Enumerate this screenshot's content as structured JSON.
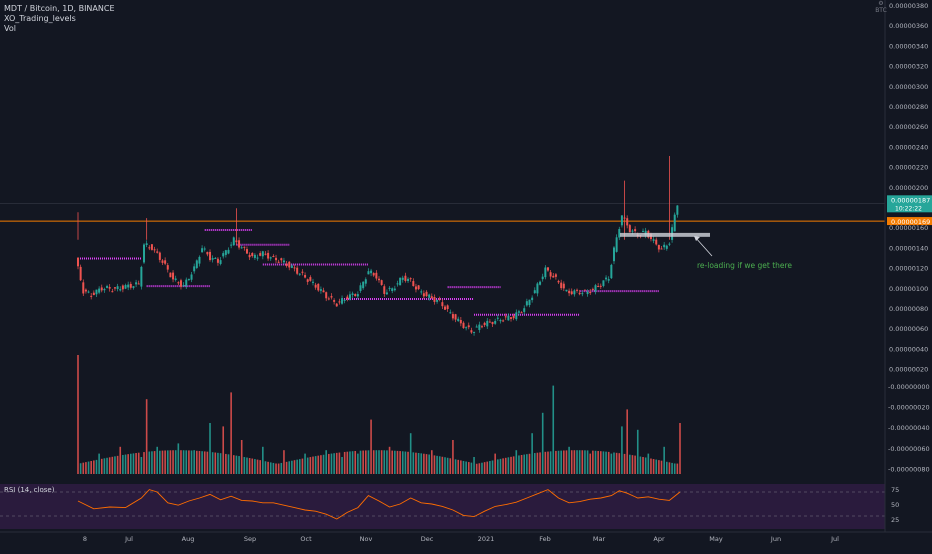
{
  "legend": {
    "symbol": "MDT / Bitcoin, 1D, BINANCE",
    "indicator": "XO_Trading_levels",
    "volume": "Vol"
  },
  "rsi": {
    "label": "RSI (14, close)"
  },
  "corner": {
    "icon": "settings-icon",
    "label": "BTC"
  },
  "annotation": {
    "text": "re-loading if we get there"
  },
  "colors": {
    "background": "#131722",
    "up": "#26a69a",
    "down": "#ef5350",
    "resistance": "#f57c00",
    "levels": "#e040fb",
    "levels_green": "#4caf50",
    "rsi_line": "#ff6d00",
    "rsi_band": "#2a1b3d",
    "text": "#b2b5be",
    "current_price_bg": "#26a69a",
    "resistance_bg": "#f57c00"
  },
  "chart_data": {
    "type": "candlestick",
    "price_axis": {
      "ticks": [
        "0.00000380",
        "0.00000360",
        "0.00000340",
        "0.00000320",
        "0.00000300",
        "0.00000280",
        "0.00000260",
        "0.00000240",
        "0.00000220",
        "0.00000200",
        "0.00000180",
        "0.00000160",
        "0.00000140",
        "0.00000120",
        "0.00000100",
        "0.00000080",
        "0.00000060",
        "0.00000040",
        "0.00000020"
      ],
      "ylim": [
        2e-07,
        3.8e-06
      ]
    },
    "volume_axis": {
      "ticks": [
        "-0.00000000",
        "-0.00000020",
        "-0.00000040",
        "-0.00000060",
        "-0.00000080"
      ]
    },
    "rsi_axis": {
      "ticks": [
        "75",
        "50",
        "25"
      ],
      "ylim": [
        0,
        100
      ],
      "overbought": 70,
      "oversold": 30
    },
    "time_axis": [
      "8",
      "Jul",
      "Aug",
      "Sep",
      "Oct",
      "Nov",
      "Dec",
      "2021",
      "Feb",
      "Mar",
      "Apr",
      "May",
      "Jun",
      "Jul"
    ],
    "current_price": {
      "value": "0.00000187",
      "countdown": "10:22:22"
    },
    "resistance_level": {
      "value": "0.00000169"
    },
    "support_box": {
      "from": 1.53e-06,
      "to": 1.57e-06
    },
    "series_close": [
      [
        0,
        1.32e-06
      ],
      [
        3,
        9.8e-07
      ],
      [
        6,
        9.4e-07
      ],
      [
        10,
        1.01e-06
      ],
      [
        15,
        1e-06
      ],
      [
        20,
        1.03e-06
      ],
      [
        24,
        1.05e-06
      ],
      [
        26,
        1.45e-06
      ],
      [
        29,
        1.42e-06
      ],
      [
        33,
        1.28e-06
      ],
      [
        37,
        1.1e-06
      ],
      [
        41,
        1.03e-06
      ],
      [
        45,
        1.21e-06
      ],
      [
        48,
        1.42e-06
      ],
      [
        51,
        1.32e-06
      ],
      [
        54,
        1.28e-06
      ],
      [
        57,
        1.38e-06
      ],
      [
        60,
        1.5e-06
      ],
      [
        63,
        1.42e-06
      ],
      [
        67,
        1.32e-06
      ],
      [
        71,
        1.36e-06
      ],
      [
        75,
        1.31e-06
      ],
      [
        79,
        1.27e-06
      ],
      [
        83,
        1.2e-06
      ],
      [
        87,
        1.12e-06
      ],
      [
        91,
        1.03e-06
      ],
      [
        95,
        9.3e-07
      ],
      [
        99,
        8.5e-07
      ],
      [
        103,
        9.2e-07
      ],
      [
        107,
        9.6e-07
      ],
      [
        111,
        1.18e-06
      ],
      [
        114,
        1.13e-06
      ],
      [
        117,
        9.7e-07
      ],
      [
        120,
        1e-06
      ],
      [
        124,
        1.12e-06
      ],
      [
        127,
        1.08e-06
      ],
      [
        130,
        9.8e-07
      ],
      [
        134,
        9.2e-07
      ],
      [
        138,
        8.7e-07
      ],
      [
        142,
        7.5e-07
      ],
      [
        146,
        6.5e-07
      ],
      [
        150,
        5.7e-07
      ],
      [
        154,
        6.4e-07
      ],
      [
        158,
        6.7e-07
      ],
      [
        162,
        7e-07
      ],
      [
        166,
        7.2e-07
      ],
      [
        170,
        8.1e-07
      ],
      [
        174,
        9.8e-07
      ],
      [
        178,
        1.2e-06
      ],
      [
        182,
        1.1e-06
      ],
      [
        186,
        9.7e-07
      ],
      [
        190,
        9.7e-07
      ],
      [
        194,
        9.7e-07
      ],
      [
        198,
        1.03e-06
      ],
      [
        202,
        1.12e-06
      ],
      [
        204,
        1.4e-06
      ],
      [
        207,
        1.75e-06
      ],
      [
        210,
        1.6e-06
      ],
      [
        213,
        1.55e-06
      ],
      [
        216,
        1.58e-06
      ],
      [
        219,
        1.48e-06
      ],
      [
        222,
        1.4e-06
      ],
      [
        225,
        1.48e-06
      ],
      [
        228,
        1.87e-06
      ]
    ],
    "series_volume": [
      [
        0,
        0.35
      ],
      [
        8,
        0.06
      ],
      [
        16,
        0.08
      ],
      [
        24,
        0.05
      ],
      [
        26,
        0.22
      ],
      [
        30,
        0.08
      ],
      [
        38,
        0.09
      ],
      [
        44,
        0.07
      ],
      [
        50,
        0.15
      ],
      [
        55,
        0.14
      ],
      [
        58,
        0.24
      ],
      [
        62,
        0.1
      ],
      [
        70,
        0.08
      ],
      [
        78,
        0.07
      ],
      [
        86,
        0.06
      ],
      [
        94,
        0.07
      ],
      [
        100,
        0.05
      ],
      [
        106,
        0.06
      ],
      [
        111,
        0.16
      ],
      [
        118,
        0.08
      ],
      [
        126,
        0.12
      ],
      [
        134,
        0.07
      ],
      [
        142,
        0.1
      ],
      [
        150,
        0.05
      ],
      [
        158,
        0.06
      ],
      [
        166,
        0.07
      ],
      [
        172,
        0.12
      ],
      [
        176,
        0.18
      ],
      [
        180,
        0.26
      ],
      [
        186,
        0.08
      ],
      [
        194,
        0.06
      ],
      [
        202,
        0.06
      ],
      [
        206,
        0.14
      ],
      [
        208,
        0.19
      ],
      [
        212,
        0.13
      ],
      [
        216,
        0.06
      ],
      [
        222,
        0.08
      ],
      [
        228,
        0.15
      ]
    ],
    "series_rsi": [
      [
        0,
        55
      ],
      [
        6,
        42
      ],
      [
        12,
        45
      ],
      [
        18,
        44
      ],
      [
        24,
        60
      ],
      [
        27,
        74
      ],
      [
        30,
        70
      ],
      [
        34,
        52
      ],
      [
        38,
        48
      ],
      [
        42,
        55
      ],
      [
        46,
        60
      ],
      [
        50,
        66
      ],
      [
        54,
        57
      ],
      [
        58,
        63
      ],
      [
        62,
        56
      ],
      [
        66,
        55
      ],
      [
        70,
        52
      ],
      [
        74,
        52
      ],
      [
        78,
        48
      ],
      [
        82,
        44
      ],
      [
        86,
        40
      ],
      [
        90,
        38
      ],
      [
        94,
        33
      ],
      [
        98,
        25
      ],
      [
        102,
        36
      ],
      [
        106,
        44
      ],
      [
        110,
        64
      ],
      [
        114,
        55
      ],
      [
        118,
        45
      ],
      [
        122,
        50
      ],
      [
        126,
        60
      ],
      [
        130,
        52
      ],
      [
        134,
        50
      ],
      [
        138,
        46
      ],
      [
        142,
        40
      ],
      [
        146,
        31
      ],
      [
        150,
        29
      ],
      [
        154,
        38
      ],
      [
        158,
        46
      ],
      [
        162,
        49
      ],
      [
        166,
        53
      ],
      [
        170,
        60
      ],
      [
        174,
        67
      ],
      [
        178,
        74
      ],
      [
        182,
        60
      ],
      [
        186,
        52
      ],
      [
        190,
        54
      ],
      [
        194,
        58
      ],
      [
        198,
        60
      ],
      [
        202,
        64
      ],
      [
        205,
        72
      ],
      [
        208,
        68
      ],
      [
        212,
        60
      ],
      [
        216,
        62
      ],
      [
        220,
        58
      ],
      [
        224,
        56
      ],
      [
        228,
        70
      ]
    ]
  }
}
